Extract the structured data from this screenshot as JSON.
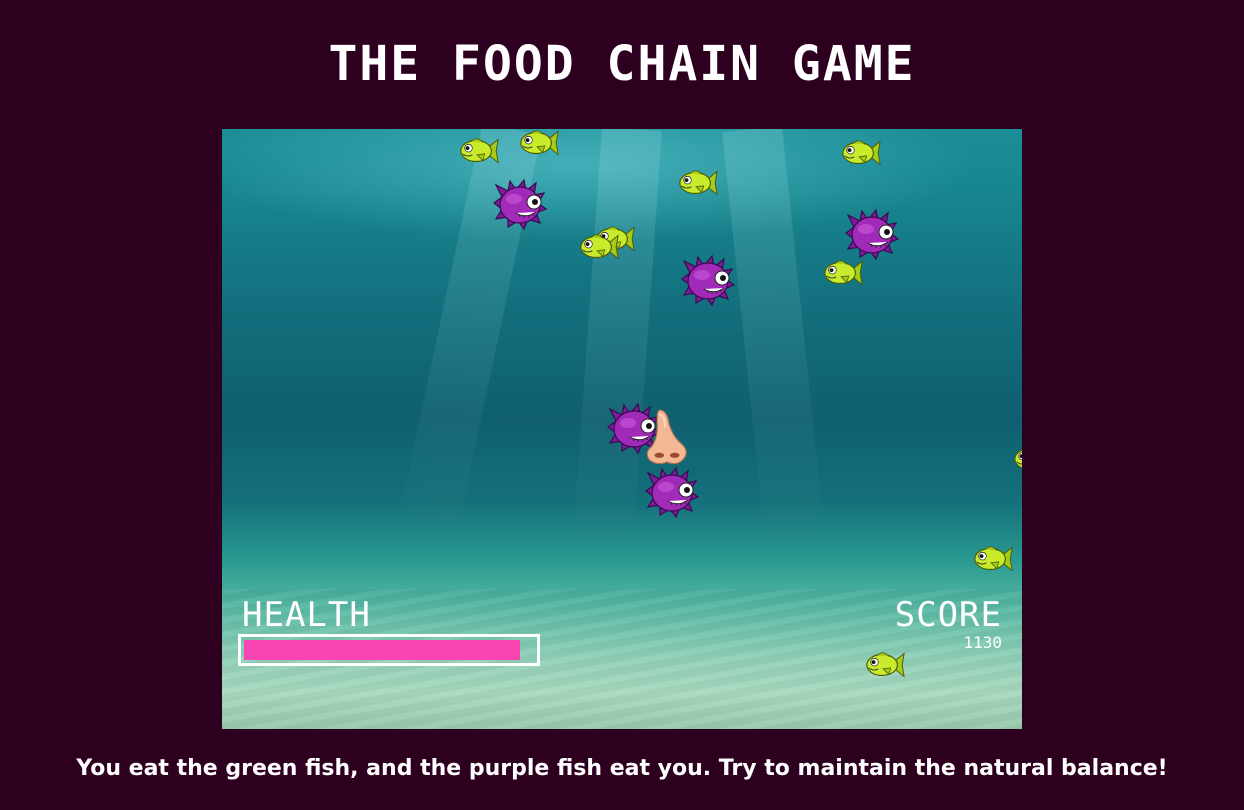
{
  "page": {
    "title": "THE FOOD CHAIN GAME",
    "instructions": "You eat the green fish, and the purple fish eat you. Try to maintain the natural balance!"
  },
  "hud": {
    "health_label": "HEALTH",
    "health_fraction": 0.95,
    "score_label": "SCORE",
    "score_value": "1130"
  },
  "colors": {
    "background": "#2e0020",
    "health_fill": "#f744b1",
    "green_fish": "#c8ec2c",
    "purple_fish": "#a22ab8"
  },
  "sprites": {
    "player": "nose-emoji",
    "prey": "green-fish",
    "predator": "purple-fish"
  }
}
